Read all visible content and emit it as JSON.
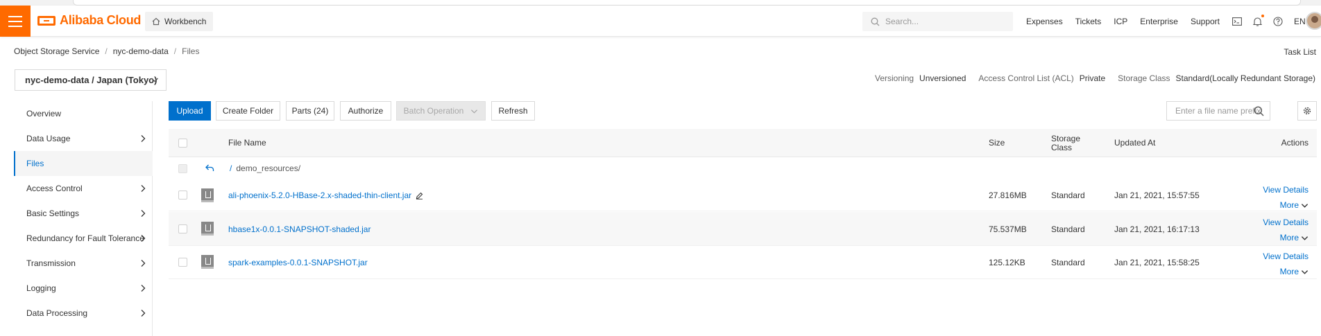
{
  "header": {
    "brand": "Alibaba Cloud",
    "workbench_label": "Workbench",
    "search_placeholder": "Search...",
    "links": [
      "Expenses",
      "Tickets",
      "ICP",
      "Enterprise",
      "Support"
    ],
    "language": "EN",
    "accent_color": "#ff6a00"
  },
  "breadcrumb": [
    "Object Storage Service",
    "nyc-demo-data",
    "Files"
  ],
  "task_list_label": "Task List",
  "bucket_selector": "nyc-demo-data / Japan (Tokyo)",
  "bucket_meta": {
    "versioning_label": "Versioning",
    "versioning_value": "Unversioned",
    "acl_label": "Access Control List (ACL)",
    "acl_value": "Private",
    "storage_class_label": "Storage Class",
    "storage_class_value": "Standard(Locally Redundant Storage)"
  },
  "sidebar": {
    "items": [
      {
        "label": "Overview",
        "has_arrow": false
      },
      {
        "label": "Data Usage",
        "has_arrow": true
      },
      {
        "label": "Files",
        "has_arrow": false,
        "active": true
      },
      {
        "label": "Access Control",
        "has_arrow": true
      },
      {
        "label": "Basic Settings",
        "has_arrow": true
      },
      {
        "label": "Redundancy for Fault Tolerance",
        "has_arrow": true
      },
      {
        "label": "Transmission",
        "has_arrow": true
      },
      {
        "label": "Logging",
        "has_arrow": true
      },
      {
        "label": "Data Processing",
        "has_arrow": true
      }
    ]
  },
  "toolbar": {
    "upload": "Upload",
    "create_folder": "Create Folder",
    "parts": "Parts (24)",
    "authorize": "Authorize",
    "batch_operation": "Batch Operation",
    "refresh": "Refresh",
    "filter_placeholder": "Enter a file name prefix",
    "primary_color": "#0070cc"
  },
  "table": {
    "columns": {
      "file_name": "File Name",
      "size": "Size",
      "storage_class_line1": "Storage",
      "storage_class_line2": "Class",
      "updated_at": "Updated At",
      "actions": "Actions"
    },
    "path": {
      "root_symbol": "/",
      "folder": "demo_resources/"
    },
    "rows": [
      {
        "name": "ali-phoenix-5.2.0-HBase-2.x-shaded-thin-client.jar",
        "size": "27.816MB",
        "storage_class": "Standard",
        "updated": "Jan 21, 2021, 15:57:55",
        "editable": true
      },
      {
        "name": "hbase1x-0.0.1-SNAPSHOT-shaded.jar",
        "size": "75.537MB",
        "storage_class": "Standard",
        "updated": "Jan 21, 2021, 16:17:13",
        "editable": false
      },
      {
        "name": "spark-examples-0.0.1-SNAPSHOT.jar",
        "size": "125.12KB",
        "storage_class": "Standard",
        "updated": "Jan 21, 2021, 15:58:25",
        "editable": false
      }
    ],
    "view_details": "View Details",
    "more": "More"
  }
}
